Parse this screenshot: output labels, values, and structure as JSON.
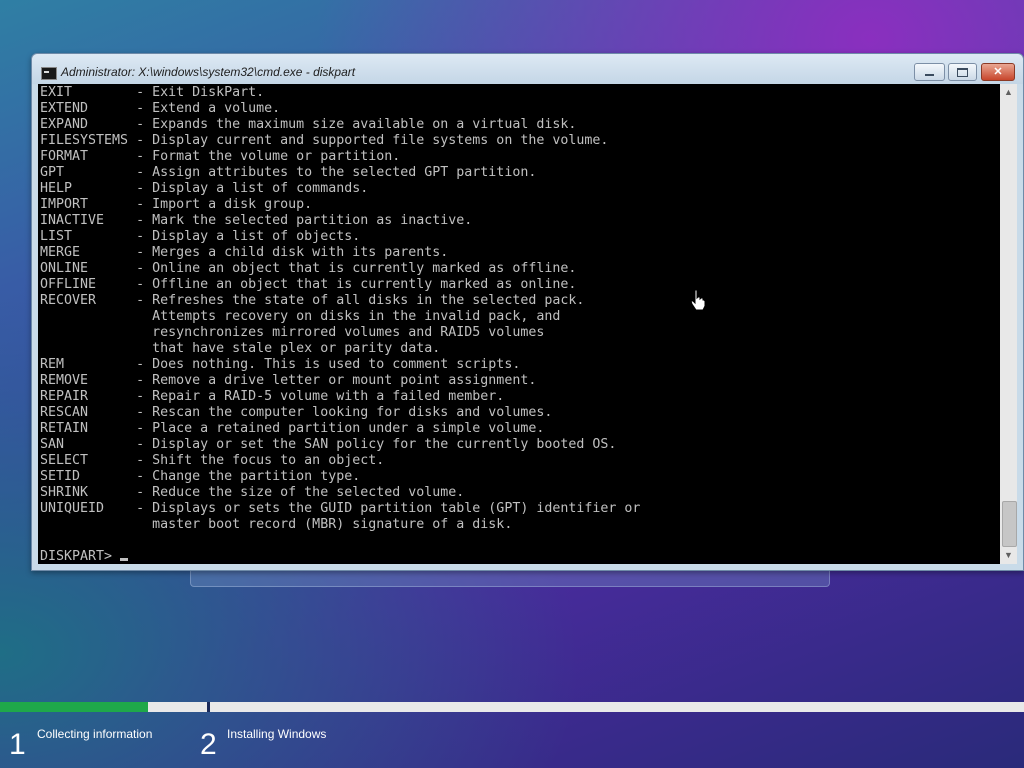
{
  "window": {
    "title": "Administrator: X:\\windows\\system32\\cmd.exe - diskpart",
    "close_glyph": "✕"
  },
  "console": {
    "lines": [
      "EXIT        - Exit DiskPart.",
      "EXTEND      - Extend a volume.",
      "EXPAND      - Expands the maximum size available on a virtual disk.",
      "FILESYSTEMS - Display current and supported file systems on the volume.",
      "FORMAT      - Format the volume or partition.",
      "GPT         - Assign attributes to the selected GPT partition.",
      "HELP        - Display a list of commands.",
      "IMPORT      - Import a disk group.",
      "INACTIVE    - Mark the selected partition as inactive.",
      "LIST        - Display a list of objects.",
      "MERGE       - Merges a child disk with its parents.",
      "ONLINE      - Online an object that is currently marked as offline.",
      "OFFLINE     - Offline an object that is currently marked as online.",
      "RECOVER     - Refreshes the state of all disks in the selected pack.",
      "              Attempts recovery on disks in the invalid pack, and",
      "              resynchronizes mirrored volumes and RAID5 volumes",
      "              that have stale plex or parity data.",
      "REM         - Does nothing. This is used to comment scripts.",
      "REMOVE      - Remove a drive letter or mount point assignment.",
      "REPAIR      - Repair a RAID-5 volume with a failed member.",
      "RESCAN      - Rescan the computer looking for disks and volumes.",
      "RETAIN      - Place a retained partition under a simple volume.",
      "SAN         - Display or set the SAN policy for the currently booted OS.",
      "SELECT      - Shift the focus to an object.",
      "SETID       - Change the partition type.",
      "SHRINK      - Reduce the size of the selected volume.",
      "UNIQUEID    - Displays or sets the GUID partition table (GPT) identifier or",
      "              master boot record (MBR) signature of a disk.",
      "",
      "DISKPART> "
    ]
  },
  "scrollbar": {
    "up_glyph": "▲",
    "down_glyph": "▼"
  },
  "setup": {
    "progress_fraction": 0.145,
    "steps": [
      {
        "number": "1",
        "label": "Collecting information"
      },
      {
        "number": "2",
        "label": "Installing Windows"
      }
    ]
  },
  "colors": {
    "console_text": "#c0c0c0",
    "console_bg": "#000000",
    "progress_green": "#1fa84a"
  }
}
